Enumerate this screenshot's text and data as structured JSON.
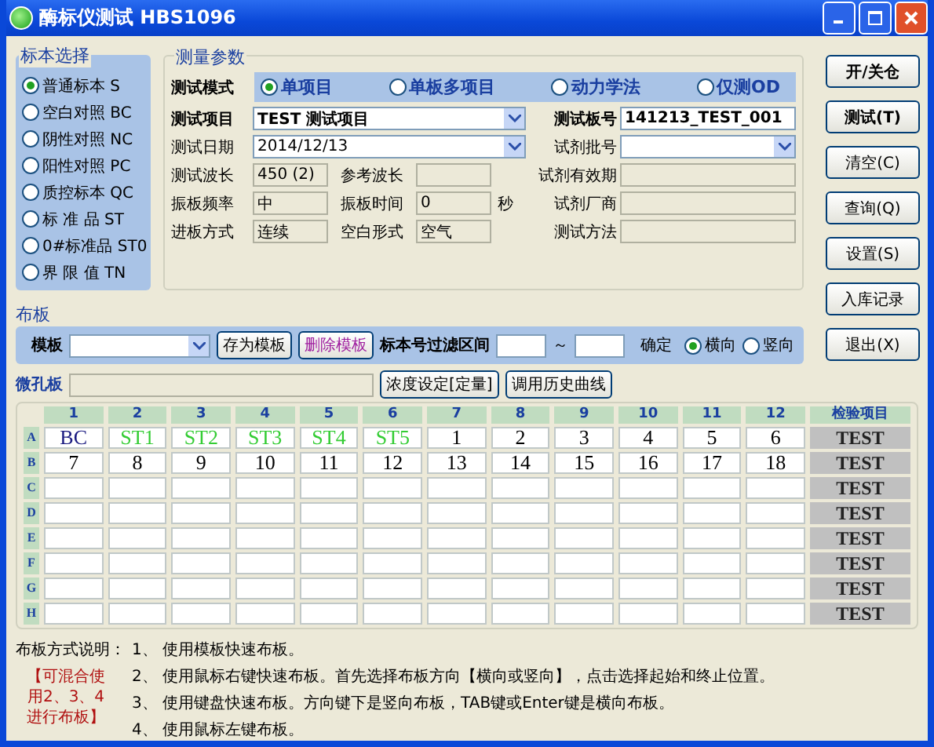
{
  "window": {
    "title": "酶标仪测试 HBS1096"
  },
  "sample_selection": {
    "title": "标本选择",
    "options": [
      {
        "label": "普通标本 S",
        "selected": true
      },
      {
        "label": "空白对照 BC",
        "selected": false
      },
      {
        "label": "阴性对照 NC",
        "selected": false
      },
      {
        "label": "阳性对照 PC",
        "selected": false
      },
      {
        "label": "质控标本 QC",
        "selected": false
      },
      {
        "label": "标 准 品 ST",
        "selected": false
      },
      {
        "label": "0#标准品 ST0",
        "selected": false
      },
      {
        "label": "界 限 值 TN",
        "selected": false
      }
    ]
  },
  "params": {
    "title": "测量参数",
    "test_mode": {
      "label": "测试模式",
      "options": [
        {
          "label": "单项目",
          "selected": true
        },
        {
          "label": "单板多项目",
          "selected": false
        },
        {
          "label": "动力学法",
          "selected": false
        },
        {
          "label": "仅测OD",
          "selected": false
        }
      ]
    },
    "test_item": {
      "label": "测试项目",
      "value": "TEST 测试项目"
    },
    "test_date": {
      "label": "测试日期",
      "value": "2014/12/13"
    },
    "pairs": [
      {
        "label": "测试波长",
        "value": "450 (2)",
        "label_2": "参考波长"
      },
      {
        "label": "振板频率",
        "value": "中",
        "label_2": "振板时间",
        "value_2": "0",
        "unit": "秒"
      },
      {
        "label": "进板方式",
        "value": "连续",
        "label_2": "空白形式",
        "value_2": "空气"
      }
    ],
    "plate_no": {
      "label": "测试板号",
      "value": "141213_TEST_001"
    },
    "reagent_batch": {
      "label": "试剂批号"
    },
    "readonly_fields": [
      {
        "label": "试剂有效期"
      },
      {
        "label": "试剂厂商"
      },
      {
        "label": "测试方法"
      }
    ]
  },
  "side_buttons": [
    {
      "label": "开/关仓",
      "bold": true
    },
    {
      "label": "测试(T)",
      "bold": true
    },
    {
      "label": "清空(C)",
      "bold": false
    },
    {
      "label": "查询(Q)",
      "bold": false
    },
    {
      "label": "设置(S)",
      "bold": false
    },
    {
      "label": "入库记录",
      "bold": false
    },
    {
      "label": "退出(X)",
      "bold": false
    }
  ],
  "layout": {
    "title": "布板",
    "template_label": "模板",
    "save_button": "存为模板",
    "delete_button": "删除模板",
    "filter_label": "标本号过滤区间",
    "range_sep": "～",
    "confirm": "确定",
    "directions": [
      {
        "label": "横向",
        "selected": true
      },
      {
        "label": "竖向",
        "selected": false
      }
    ]
  },
  "plate": {
    "label": "微孔板",
    "concentration_button": "浓度设定[定量]",
    "history_button": "调用历史曲线",
    "columns": [
      "1",
      "2",
      "3",
      "4",
      "5",
      "6",
      "7",
      "8",
      "9",
      "10",
      "11",
      "12",
      "检验项目"
    ],
    "rows": [
      {
        "label": "A",
        "test": "TEST",
        "cells": [
          {
            "text": "BC",
            "color": "#1a1a80"
          },
          {
            "text": "ST1",
            "color": "#33cc33"
          },
          {
            "text": "ST2",
            "color": "#33cc33"
          },
          {
            "text": "ST3",
            "color": "#33cc33"
          },
          {
            "text": "ST4",
            "color": "#33cc33"
          },
          {
            "text": "ST5",
            "color": "#33cc33"
          },
          {
            "text": "1",
            "color": "#000000"
          },
          {
            "text": "2",
            "color": "#000000"
          },
          {
            "text": "3",
            "color": "#000000"
          },
          {
            "text": "4",
            "color": "#000000"
          },
          {
            "text": "5",
            "color": "#000000"
          },
          {
            "text": "6",
            "color": "#000000"
          }
        ]
      },
      {
        "label": "B",
        "test": "TEST",
        "cells": [
          {
            "text": "7",
            "color": "#000000"
          },
          {
            "text": "8",
            "color": "#000000"
          },
          {
            "text": "9",
            "color": "#000000"
          },
          {
            "text": "10",
            "color": "#000000"
          },
          {
            "text": "11",
            "color": "#000000"
          },
          {
            "text": "12",
            "color": "#000000"
          },
          {
            "text": "13",
            "color": "#000000"
          },
          {
            "text": "14",
            "color": "#000000"
          },
          {
            "text": "15",
            "color": "#000000"
          },
          {
            "text": "16",
            "color": "#000000"
          },
          {
            "text": "17",
            "color": "#000000"
          },
          {
            "text": "18",
            "color": "#000000"
          }
        ]
      },
      {
        "label": "C",
        "test": "TEST"
      },
      {
        "label": "D",
        "test": "TEST"
      },
      {
        "label": "E",
        "test": "TEST"
      },
      {
        "label": "F",
        "test": "TEST"
      },
      {
        "label": "G",
        "test": "TEST"
      },
      {
        "label": "H",
        "test": "TEST"
      }
    ]
  },
  "notes": {
    "heading": "布板方式说明：",
    "remark": "【可混合使用2、3、4进行布板】",
    "lines": [
      "1、 使用模板快速布板。",
      "2、 使用鼠标右键快速布板。首先选择布板方向【横向或竖向】，点击选择起始和终止位置。",
      "3、 使用键盘快速布板。方向键下是竖向布板，TAB键或Enter键是横向布板。",
      "4、 使用鼠标左键布板。"
    ]
  }
}
